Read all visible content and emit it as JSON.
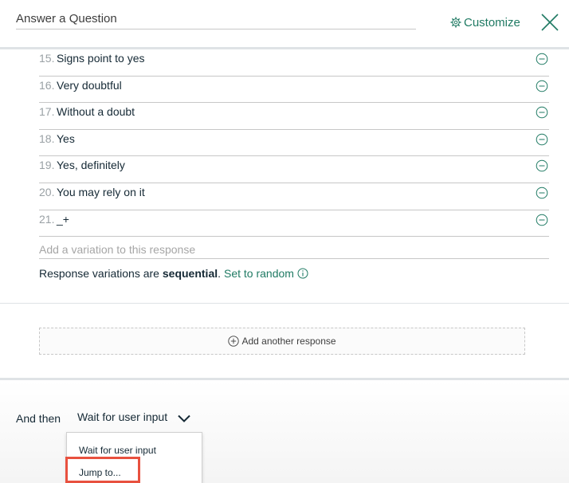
{
  "header": {
    "title": "Answer a Question",
    "customize_label": "Customize"
  },
  "responses": [
    {
      "num": "15.",
      "text": "Signs point to yes"
    },
    {
      "num": "16.",
      "text": "Very doubtful"
    },
    {
      "num": "17.",
      "text": "Without a doubt"
    },
    {
      "num": "18.",
      "text": "Yes"
    },
    {
      "num": "19.",
      "text": "Yes, definitely"
    },
    {
      "num": "20.",
      "text": "You may rely on it"
    },
    {
      "num": "21.",
      "text": "_+"
    }
  ],
  "add_variation_placeholder": "Add a variation to this response",
  "variations": {
    "prefix": "Response variations are",
    "mode": "sequential",
    "suffix": ".",
    "link": "Set to random"
  },
  "add_response_label": "Add another response",
  "next_step": {
    "label": "And then",
    "selected": "Wait for user input",
    "options": [
      "Wait for user input",
      "Jump to..."
    ]
  },
  "colors": {
    "accent": "#1f7a63",
    "highlight": "#e8513f"
  }
}
